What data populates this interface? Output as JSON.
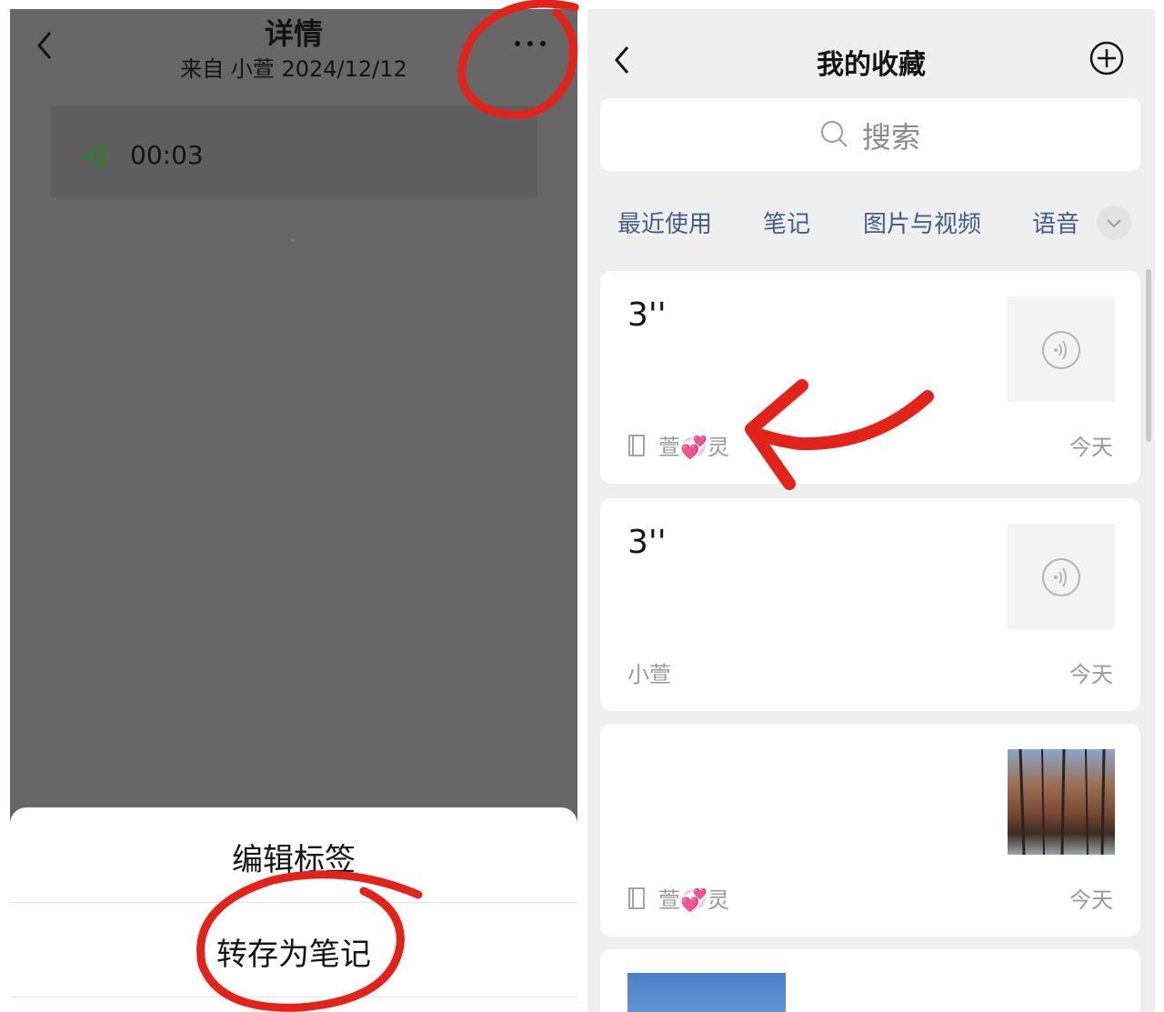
{
  "left_panel": {
    "title": "详情",
    "subtitle": "来自 小萱 2024/12/12",
    "voice_duration": "00:03",
    "sheet": {
      "edit_tags": "编辑标签",
      "save_as_note": "转存为笔记"
    }
  },
  "right_panel": {
    "title": "我的收藏",
    "search_placeholder": "搜索",
    "tabs": [
      "最近使用",
      "笔记",
      "图片与视频",
      "语音"
    ],
    "cards": [
      {
        "main": "3''",
        "source": "萱💞灵",
        "date": "今天"
      },
      {
        "main": "3''",
        "source": "小萱",
        "date": "今天"
      },
      {
        "main": "",
        "source": "萱💞灵",
        "date": "今天"
      }
    ]
  },
  "colors": {
    "overlay_gray": "#676767",
    "annotation_red": "#e2231a",
    "tab_blue": "#3f5f8a",
    "voice_green": "#1f8a1f"
  }
}
